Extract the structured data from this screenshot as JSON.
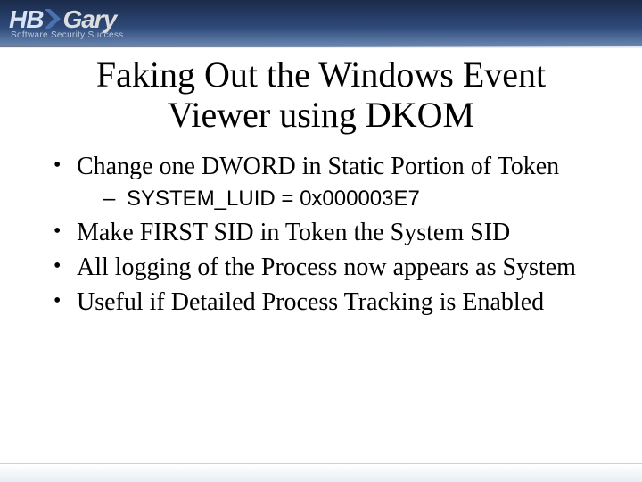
{
  "logo": {
    "hb": "HB",
    "gary": "Gary",
    "tagline": "Software Security Success"
  },
  "title": "Faking Out the Windows Event Viewer using DKOM",
  "bullets": [
    {
      "text": "Change one DWORD in Static Portion of Token",
      "sub": [
        "SYSTEM_LUID = 0x000003E7"
      ]
    },
    {
      "text": "Make FIRST SID in Token the System SID"
    },
    {
      "text": "All logging of the Process now appears as System"
    },
    {
      "text": "Useful if Detailed Process Tracking is Enabled"
    }
  ]
}
